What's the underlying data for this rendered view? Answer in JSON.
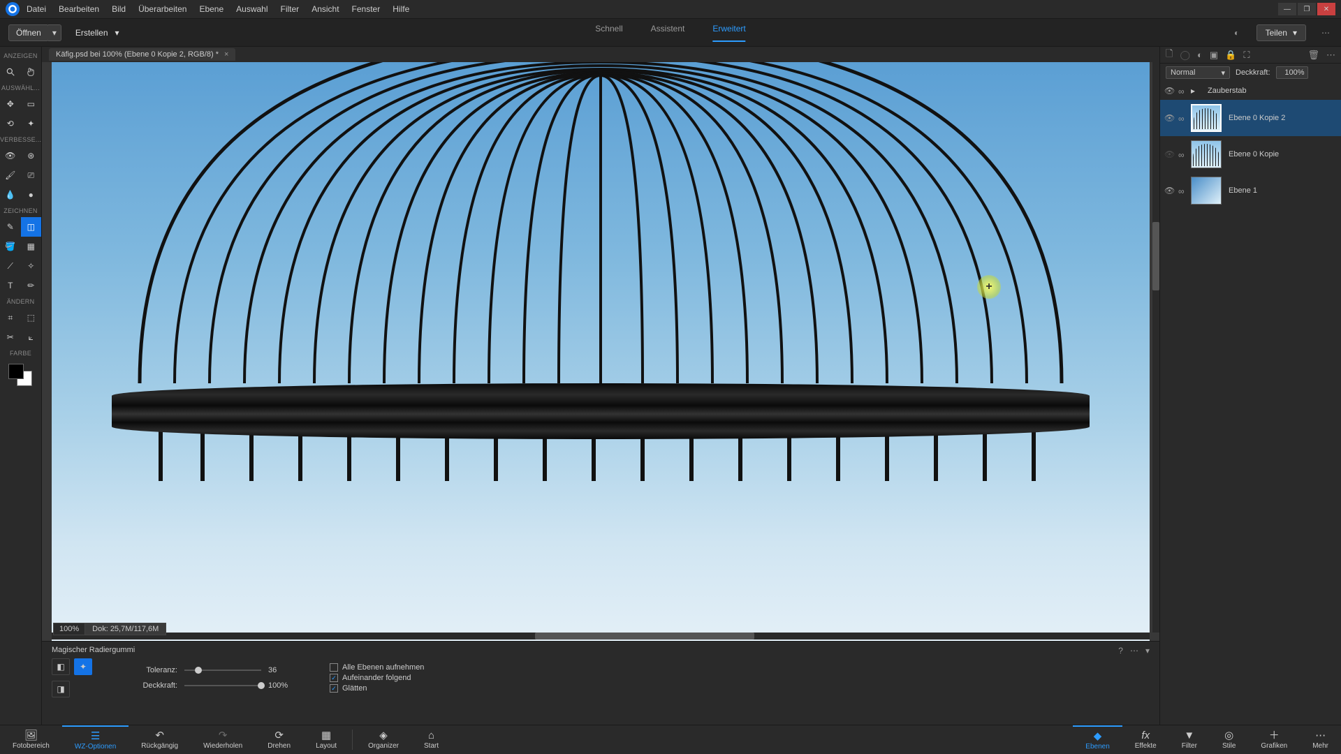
{
  "menubar": {
    "items": [
      "Datei",
      "Bearbeiten",
      "Bild",
      "Überarbeiten",
      "Ebene",
      "Auswahl",
      "Filter",
      "Ansicht",
      "Fenster",
      "Hilfe"
    ]
  },
  "actionbar": {
    "open_label": "Öffnen",
    "create_label": "Erstellen",
    "share_label": "Teilen",
    "modes": [
      "Schnell",
      "Assistent",
      "Erweitert"
    ],
    "active_mode": 2
  },
  "document": {
    "tab_title": "Käfig.psd bei 100% (Ebene 0 Kopie 2, RGB/8) *",
    "zoom": "100%",
    "doc_size": "Dok: 25,7M/117,6M"
  },
  "left_toolbar": {
    "sections": [
      "ANZEIGEN",
      "AUSWÄHL...",
      "VERBESSE...",
      "ZEICHNEN",
      "ÄNDERN",
      "FARBE"
    ]
  },
  "tool_options": {
    "tool_name": "Magischer Radiergummi",
    "tolerance_label": "Toleranz:",
    "tolerance_value": "36",
    "opacity_label": "Deckkraft:",
    "opacity_value": "100%",
    "checkboxes": [
      {
        "label": "Alle Ebenen aufnehmen",
        "checked": false
      },
      {
        "label": "Aufeinander folgend",
        "checked": true
      },
      {
        "label": "Glätten",
        "checked": true
      }
    ]
  },
  "layers_panel": {
    "blend_mode": "Normal",
    "opacity_label": "Deckkraft:",
    "opacity_value": "100%",
    "adjustment_row": "Zauberstab",
    "layers": [
      {
        "name": "Ebene 0 Kopie 2",
        "selected": true,
        "kind": "cage"
      },
      {
        "name": "Ebene 0 Kopie",
        "selected": false,
        "kind": "cage"
      },
      {
        "name": "Ebene 1",
        "selected": false,
        "kind": "grad"
      }
    ]
  },
  "bottom_bar": {
    "left": [
      {
        "label": "Fotobereich",
        "icon": "image"
      },
      {
        "label": "WZ-Optionen",
        "icon": "sliders",
        "active": true
      },
      {
        "label": "Rückgängig",
        "icon": "undo"
      },
      {
        "label": "Wiederholen",
        "icon": "redo"
      },
      {
        "label": "Drehen",
        "icon": "rotate"
      },
      {
        "label": "Layout",
        "icon": "grid"
      },
      {
        "label": "Organizer",
        "icon": "cube"
      },
      {
        "label": "Start",
        "icon": "home"
      }
    ],
    "right": [
      {
        "label": "Ebenen",
        "icon": "layers",
        "active": true
      },
      {
        "label": "Effekte",
        "icon": "fx"
      },
      {
        "label": "Filter",
        "icon": "funnel"
      },
      {
        "label": "Stile",
        "icon": "styles"
      },
      {
        "label": "Grafiken",
        "icon": "plus"
      },
      {
        "label": "Mehr",
        "icon": "more"
      }
    ]
  }
}
